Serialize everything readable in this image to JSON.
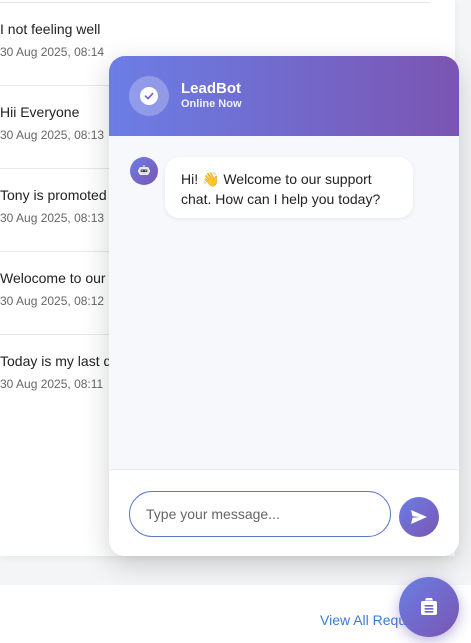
{
  "feed": {
    "items": [
      {
        "title": "I not feeling well",
        "time": "30 Aug 2025, 08:14"
      },
      {
        "title": "Hii Everyone",
        "time": "30 Aug 2025, 08:13"
      },
      {
        "title": "Tony is promoted",
        "time": "30 Aug 2025, 08:13"
      },
      {
        "title": "Welocome to our",
        "time": "30 Aug 2025, 08:12"
      },
      {
        "title": "Today is my last da",
        "time": "30 Aug 2025, 08:11"
      }
    ],
    "view_all_label": "View All Requ"
  },
  "chat": {
    "bot_name": "LeadBot",
    "bot_status": "Online Now",
    "message_line1": "Hi! 👋 Welcome to our support",
    "message_line2": "chat. How can I help you today?",
    "input_placeholder": "Type your message...",
    "send_icon": "send-icon",
    "avatar_icon": "robot-icon",
    "header_icon": "check-circle-icon"
  },
  "fab": {
    "icon": "document-icon"
  },
  "colors": {
    "gradient_start": "#6b7ee6",
    "gradient_end": "#7a55b2",
    "link": "#3a7bd5"
  }
}
